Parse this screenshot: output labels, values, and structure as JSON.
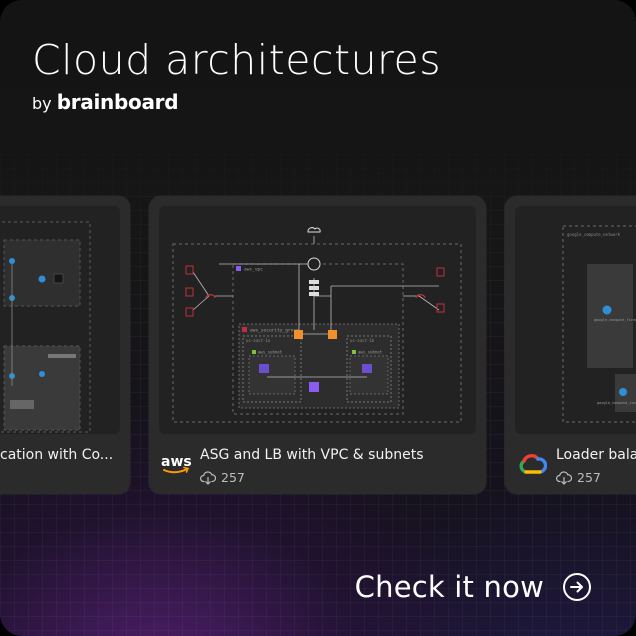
{
  "header": {
    "title": "Cloud architectures",
    "by": "by",
    "brand": "brainboard"
  },
  "cards": [
    {
      "title": "cation with Co...",
      "count": ""
    },
    {
      "title": "ASG and LB with VPC & subnets",
      "count": "257",
      "provider_icon": "aws-logo"
    },
    {
      "title": "Loader bala",
      "count": "257",
      "provider_icon": "google-cloud-logo"
    }
  ],
  "preview_labels": {
    "vpc": "aws_vpc",
    "sg": "aws_security_group",
    "az_a": "us-east-1a",
    "az_b": "us-east-1b",
    "subnet": "aws_subnet",
    "gcp_network": "google_compute_network",
    "gcp_firewall": "google_compute_firewall",
    "gcp_instance": "google_compute_instance"
  },
  "cta": {
    "label": "Check it now",
    "icon": "arrow-right-circle-icon"
  },
  "colors": {
    "accent_red": "#c0303c",
    "accent_orange": "#f0902a",
    "accent_purple": "#8a5cf0",
    "aws_orange": "#ff9900"
  }
}
